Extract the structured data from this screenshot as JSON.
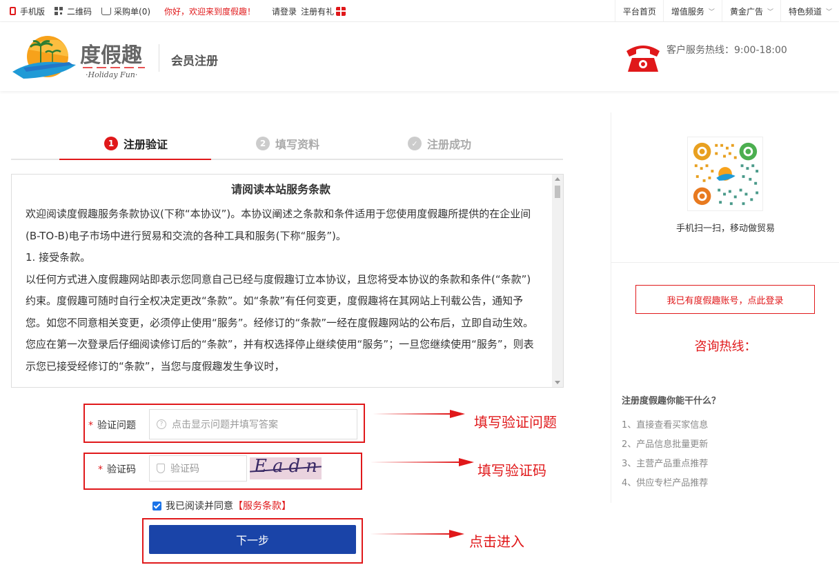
{
  "topbar": {
    "mobile": "手机版",
    "qrcode": "二维码",
    "cart": "采购单(0)",
    "welcome": "你好，欢迎来到度假趣！",
    "login": "请登录",
    "register": "注册有礼",
    "nav": [
      "平台首页",
      "增值服务",
      "黄金广告",
      "特色频道"
    ]
  },
  "header": {
    "logo_cn": "度假趣",
    "logo_en": "·Holiday Fun·",
    "subtitle": "会员注册",
    "hotline": "客户服务热线：9:00-18:00"
  },
  "steps": [
    {
      "num": "1",
      "label": "注册验证"
    },
    {
      "num": "2",
      "label": "填写资料"
    },
    {
      "num": "✓",
      "label": "注册成功"
    }
  ],
  "terms": {
    "title": "请阅读本站服务条款",
    "paragraphs": [
      "欢迎阅读度假趣服务条款协议(下称“本协议”)。本协议阐述之条款和条件适用于您使用度假趣所提供的在企业间(B-TO-B)电子市场中进行贸易和交流的各种工具和服务(下称“服务”)。",
      "1. 接受条款。",
      "以任何方式进入度假趣网站即表示您同意自己已经与度假趣订立本协议，且您将受本协议的条款和条件(“条款”)约束。度假趣可随时自行全权决定更改“条款”。如“条款”有任何变更，度假趣将在其网站上刊载公告，通知予您。如您不同意相关变更，必须停止使用“服务”。经修订的“条款”一经在度假趣网站的公布后，立即自动生效。您应在第一次登录后仔细阅读修订后的“条款”，并有权选择停止继续使用“服务”；一旦您继续使用“服务”，则表示您已接受经修订的“条款”，当您与度假趣发生争议时，"
    ]
  },
  "form": {
    "question_label": "验证问题",
    "question_placeholder": "点击显示问题并填写答案",
    "code_label": "验证码",
    "code_placeholder": "验证码",
    "captcha_text": "Eadn",
    "agree_text": "我已阅读并同意",
    "agree_link": "【服务条款】",
    "agree_checked": true,
    "next_button": "下一步",
    "required_mark": "*"
  },
  "annotations": {
    "question": "填写验证问题",
    "code": "填写验证码",
    "next": "点击进入"
  },
  "right_panel": {
    "qr_caption": "手机扫一扫，移动做贸易",
    "login_button": "我已有度假趣账号，点此登录",
    "consult": "咨询热线：",
    "what_title": "注册度假趣你能干什么？",
    "what_items": [
      "1、直接查看买家信息",
      "2、产品信息批量更新",
      "3、主营产品重点推荐",
      "4、供应专栏产品推荐"
    ]
  },
  "colors": {
    "accent_red": "#e0181a",
    "button_blue": "#1a44a8"
  }
}
